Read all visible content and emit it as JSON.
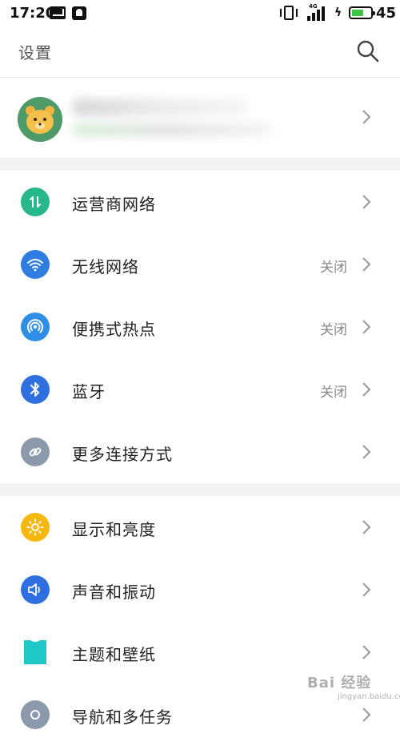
{
  "status_bar": {
    "time": "17:20",
    "battery_level": "45",
    "network_label": "4G"
  },
  "header": {
    "title": "设置",
    "search_icon": "search-icon"
  },
  "profile": {
    "avatar_icon": "cartoon-avatar-icon"
  },
  "sections": [
    {
      "items": [
        {
          "label": "运营商网络",
          "status": "",
          "icon": "carrier-network-icon",
          "icon_color": "#27b78b"
        },
        {
          "label": "无线网络",
          "status": "关闭",
          "icon": "wifi-icon",
          "icon_color": "#2f7de1"
        },
        {
          "label": "便携式热点",
          "status": "关闭",
          "icon": "hotspot-icon",
          "icon_color": "#2f8fe6"
        },
        {
          "label": "蓝牙",
          "status": "关闭",
          "icon": "bluetooth-icon",
          "icon_color": "#2f6fe0"
        },
        {
          "label": "更多连接方式",
          "status": "",
          "icon": "link-icon",
          "icon_color": "#8c98ac"
        }
      ]
    },
    {
      "items": [
        {
          "label": "显示和亮度",
          "status": "",
          "icon": "brightness-icon",
          "icon_color": "#f6b80d"
        },
        {
          "label": "声音和振动",
          "status": "",
          "icon": "sound-icon",
          "icon_color": "#2f6fe0"
        },
        {
          "label": "主题和壁纸",
          "status": "",
          "icon": "theme-icon",
          "icon_color": "#20c8c8"
        },
        {
          "label": "导航和多任务",
          "status": "",
          "icon": "navigation-icon",
          "icon_color": "#8c98ac"
        }
      ]
    }
  ],
  "watermark": {
    "text": "Bai 经验",
    "sub": "jingyan.baidu.com"
  }
}
